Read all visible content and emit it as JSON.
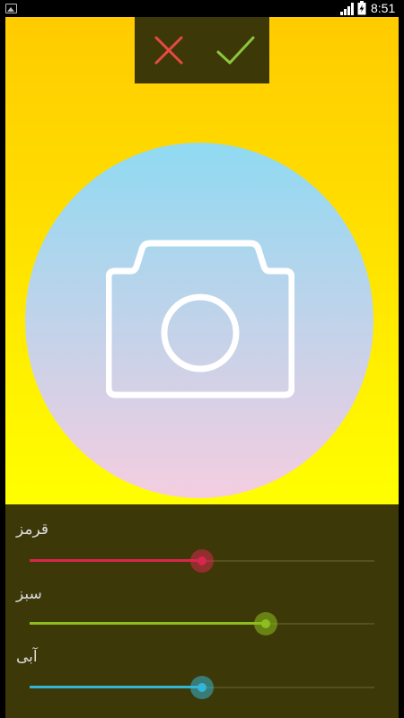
{
  "status_bar": {
    "time": "8:51",
    "icons": [
      "image-notification-icon",
      "signal-icon",
      "battery-charging-icon"
    ]
  },
  "action_bar": {
    "icons": [
      "close-icon",
      "check-icon"
    ],
    "colors": {
      "close": "#e84a43",
      "check": "#8cc63f",
      "background": "#3d3808"
    }
  },
  "preview": {
    "icon": "camera-icon",
    "colors": {
      "top": "#8fdaf2",
      "bottom": "#f5cde0"
    }
  },
  "stage": {
    "colors": {
      "top": "#ffcb00",
      "bottom": "#ffff00"
    }
  },
  "sliders": [
    {
      "key": "red",
      "label": "قرمز",
      "value": 0.5,
      "color": "#d8264e",
      "halo": "rgba(216,38,78,0.55)"
    },
    {
      "key": "green",
      "label": "سبز",
      "value": 0.684,
      "color": "#8cbf1e",
      "halo": "rgba(140,191,30,0.55)"
    },
    {
      "key": "blue",
      "label": "آبی",
      "value": 0.5,
      "color": "#35b5d6",
      "halo": "rgba(53,181,214,0.55)"
    }
  ]
}
